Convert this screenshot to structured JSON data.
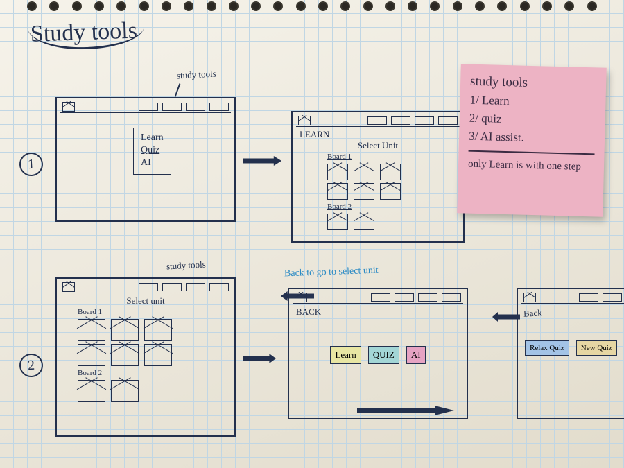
{
  "page_title": "Study tools",
  "step_numbers": {
    "one": "1",
    "two": "2"
  },
  "annotations": {
    "study_tools_arrow": "study tools",
    "study_tools_arrow_2": "study tools",
    "back_to_select": "Back to go to select unit",
    "back_label": "Back",
    "back_label_2": "Back"
  },
  "sticky": {
    "heading": "study tools",
    "items": [
      "1/ Learn",
      "2/ quiz",
      "3/ AI assist."
    ],
    "footer": "only Learn is with one step"
  },
  "frame1": {
    "menu": {
      "learn": "Learn",
      "quiz": "Quiz",
      "ai": "AI"
    }
  },
  "frame2": {
    "breadcrumb": "LEARN",
    "heading": "Select Unit",
    "board1": "Board 1",
    "board2": "Board 2"
  },
  "frame3": {
    "heading": "Select unit",
    "board1": "Board 1",
    "board2": "Board 2"
  },
  "frame4": {
    "back": "BACK",
    "tiles": {
      "learn": "Learn",
      "quiz": "QUIZ",
      "ai": "AI"
    }
  },
  "frame5": {
    "tiles": {
      "relax": "Relax Quiz",
      "new": "New Quiz"
    }
  }
}
